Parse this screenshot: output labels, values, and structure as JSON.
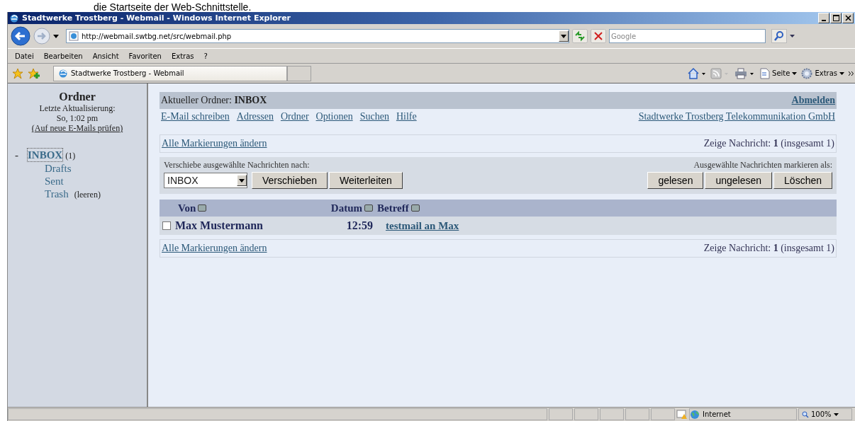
{
  "caption": "die Startseite der Web-Schnittstelle.",
  "window": {
    "title": "Stadtwerke Trostberg - Webmail - Windows Internet Explorer"
  },
  "address_bar": {
    "url": "http://webmail.swtbg.net/src/webmail.php"
  },
  "search": {
    "placeholder": "Google"
  },
  "menu": [
    "Datei",
    "Bearbeiten",
    "Ansicht",
    "Favoriten",
    "Extras",
    "?"
  ],
  "tab": {
    "title": "Stadtwerke Trostberg - Webmail"
  },
  "command_bar": [
    {
      "kind": "home"
    },
    {
      "kind": "feed"
    },
    {
      "kind": "print"
    },
    {
      "kind": "page",
      "label": "Seite"
    },
    {
      "kind": "tools",
      "label": "Extras"
    }
  ],
  "sidebar": {
    "title": "Ordner",
    "updated_label": "Letzte Aktualisierung:",
    "updated_time": "So, 1:02 pm",
    "check_link": "(Auf neue E-Mails prüfen)",
    "folders": [
      {
        "toggle": "-",
        "name": "INBOX",
        "count": "(1)",
        "selected": true,
        "children": [
          {
            "name": "Drafts",
            "selected": false
          },
          {
            "name": "Sent",
            "selected": false
          },
          {
            "name": "Trash",
            "action": "(leeren)",
            "selected": false
          }
        ]
      }
    ]
  },
  "main": {
    "folder_label": "Aktueller Ordner:",
    "folder": "INBOX",
    "logout": "Abmelden",
    "nav": [
      "E-Mail schreiben",
      "Adressen",
      "Ordner",
      "Optionen",
      "Suchen",
      "Hilfe"
    ],
    "company_link": "Stadtwerke Trostberg Telekommunikation GmbH",
    "toggle_all": "Alle Markierungen ändern",
    "showing": "Zeige Nachricht: **1** (insgesamt 1)",
    "move_label": "Verschiebe ausgewählte Nachrichten nach:",
    "move_target": "INBOX",
    "move_buttons": [
      "Verschieben",
      "Weiterleiten"
    ],
    "mark_label": "Ausgewählte Nachrichten markieren als:",
    "mark_buttons": [
      "gelesen",
      "ungelesen",
      "Löschen"
    ],
    "table": {
      "columns": [
        "Von",
        "Datum",
        "Betreff"
      ],
      "rows": [
        {
          "checked": false,
          "from": "Max Mustermann",
          "date": "12:59",
          "subject": "testmail an Max"
        }
      ]
    },
    "footer_toggle_all": "Alle Markierungen ändern",
    "footer_showing": "Zeige Nachricht: **1** (insgesamt 1)"
  },
  "status_bar": {
    "zone": "Internet",
    "zoom": "100%"
  }
}
